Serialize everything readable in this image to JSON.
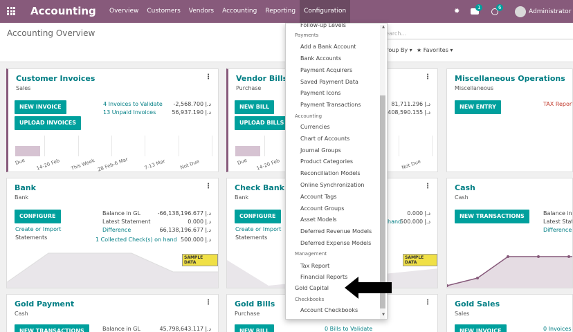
{
  "navbar": {
    "brand": "Accounting",
    "menu": [
      "Overview",
      "Customers",
      "Vendors",
      "Accounting",
      "Reporting",
      "Configuration"
    ],
    "chat_badge": "1",
    "activity_badge": "6",
    "user": "Administrator (a",
    "accent": "#875a7b"
  },
  "control_panel": {
    "title": "Accounting Overview",
    "search_placeholder": "Search...",
    "group_by": "Group By",
    "favorites": "Favorites"
  },
  "cards": {
    "customer_invoices": {
      "name": "Customer Invoices",
      "type": "Sales",
      "btn1": "NEW INVOICE",
      "btn2": "UPLOAD INVOICES",
      "link1": "4 Invoices to Validate",
      "amount1": "-2,568.700 د.إ",
      "link2": "13 Unpaid Invoices",
      "amount2": "56,937.190 د.إ",
      "ticks": [
        "Due",
        "14-20 Feb",
        "This Week",
        "28 Feb-6 Mar",
        "7-13 Mar",
        "Not Due"
      ],
      "bar_values": [
        1,
        0,
        0,
        0,
        0,
        0
      ]
    },
    "vendor_bills": {
      "name": "Vendor Bills",
      "type": "Purchase",
      "btn1": "NEW BILL",
      "btn2": "UPLOAD BILLS",
      "amount1": "81,711.296 د.إ",
      "amount2": "408,590.155 د.إ",
      "ticks": [
        "Due",
        "14-20 Feb",
        "Not Due"
      ],
      "bar_values": [
        1,
        0,
        0,
        0,
        0,
        0
      ]
    },
    "misc": {
      "name": "Miscellaneous Operations",
      "type": "Miscellaneous",
      "btn1": "NEW ENTRY",
      "tax_report": "TAX Report"
    },
    "bank": {
      "name": "Bank",
      "type": "Bank",
      "btn1": "CONFIGURE",
      "create_import": "Create or Import",
      "statements": "Statements",
      "balance_gl_label": "Balance in GL",
      "balance_gl": "-66,138,196.677 د.إ",
      "latest_label": "Latest Statement",
      "latest": "0.000 د.إ",
      "difference_label": "Difference",
      "difference": "66,138,196.677 د.إ",
      "checks": "1 Collected Check(s) on hand",
      "checks_amount": "500.000 د.إ",
      "sample": "SAMPLE DATA"
    },
    "check_bank": {
      "name": "Check Bank",
      "type": "Bank",
      "btn1": "CONFIGURE",
      "create_import": "Create or Import",
      "statements": "Statements",
      "latest": "0.000 د.إ",
      "checks_amount": "500.000 د.إ",
      "checks_partial": "hand",
      "sample": "SAMPLE DATA"
    },
    "cash": {
      "name": "Cash",
      "type": "Cash",
      "btn1": "NEW TRANSACTIONS",
      "balance_label": "Balance in (",
      "latest_label": "Latest State",
      "difference_label": "Difference"
    },
    "gold_payment": {
      "name": "Gold Payment",
      "type": "Cash",
      "btn1": "NEW TRANSACTIONS",
      "balance_gl_label": "Balance in GL",
      "balance_gl": "45,798,643.117 د.إ"
    },
    "gold_bills": {
      "name": "Gold Bills",
      "type": "Purchase",
      "btn1": "NEW BILL",
      "link1": "0 Bills to Validate"
    },
    "gold_sales": {
      "name": "Gold Sales",
      "type": "Sales",
      "btn1": "NEW INVOICE",
      "link1": "0 Invoices t"
    }
  },
  "dropdown": {
    "top_item": "Follow-up Levels",
    "payments_header": "Payments",
    "payments": [
      "Add a Bank Account",
      "Bank Accounts",
      "Payment Acquirers",
      "Saved Payment Data",
      "Payment Icons",
      "Payment Transactions"
    ],
    "accounting_header": "Accounting",
    "accounting": [
      "Currencies",
      "Chart of Accounts",
      "Journal Groups",
      "Product Categories",
      "Reconciliation Models",
      "Online Synchronization",
      "Account Tags",
      "Account Groups",
      "Asset Models",
      "Deferred Revenue Models",
      "Deferred Expense Models"
    ],
    "management_header": "Management",
    "management": [
      "Tax Report",
      "Financial Reports"
    ],
    "gold_capital": "Gold Capital",
    "checkbooks_header": "Checkbooks",
    "checkbooks": [
      "Account Checkbooks"
    ]
  }
}
